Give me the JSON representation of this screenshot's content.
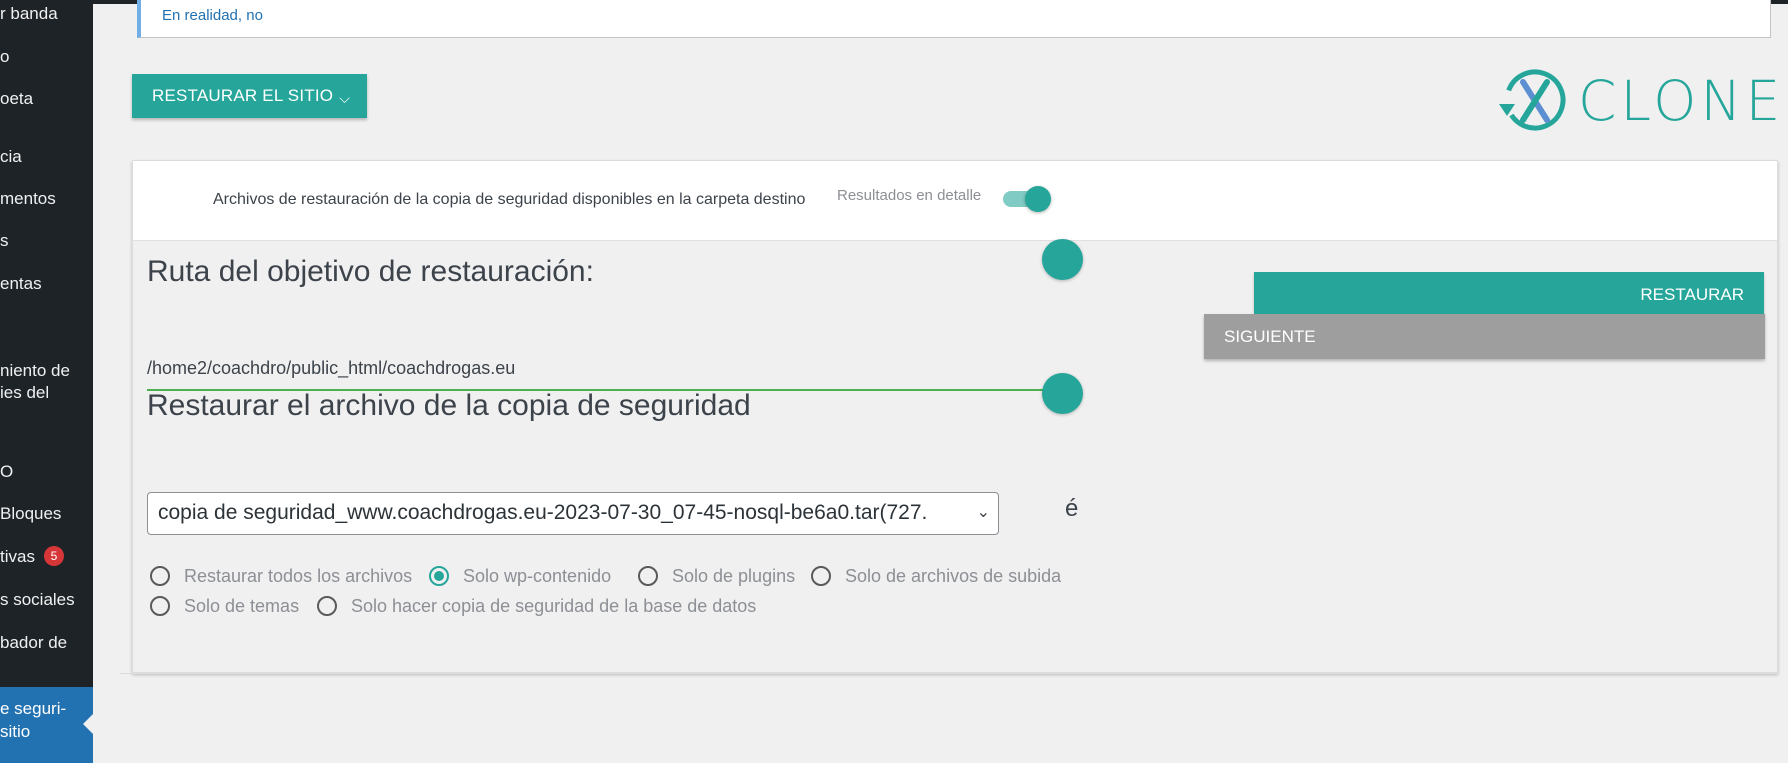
{
  "sidebar": {
    "items": [
      {
        "label": "r banda"
      },
      {
        "label": "o"
      },
      {
        "label": "oeta"
      },
      {
        "label": "cia"
      },
      {
        "label": "mentos"
      },
      {
        "label": "s"
      },
      {
        "label": "entas"
      },
      {
        "label": "niento de"
      },
      {
        "label": "ies del"
      },
      {
        "label": "O"
      },
      {
        "label": "Bloques"
      },
      {
        "label": "tivas",
        "badge": "5"
      },
      {
        "label": "s sociales"
      },
      {
        "label": "bador de"
      }
    ],
    "active_line1": "e seguri-",
    "active_line2": "sitio"
  },
  "notice": {
    "text": "En realidad, no"
  },
  "toolbar": {
    "restore_site_label": "RESTAURAR EL SITIO"
  },
  "logo": {
    "text": "CLONER",
    "letter": "X"
  },
  "card": {
    "header_text": "Archivos de restauración de la copia de seguridad disponibles en la carpeta destino",
    "detail_label": "Resultados en detalle",
    "detail_toggle_on": true
  },
  "restore_target": {
    "title": "Ruta del objetivo de restauración:",
    "path_value": "/home2/coachdro/public_html/coachdrogas.eu"
  },
  "restore_file": {
    "title": "Restaurar el archivo de la copia de seguridad",
    "selected": "copia de seguridad_www.coachdrogas.eu-2023-07-30_07-45-nosql-be6a0.tar(727.",
    "trailing_char": "é"
  },
  "restore_options": [
    {
      "label": "Restaurar todos los archivos",
      "checked": false
    },
    {
      "label": "Solo wp-contenido",
      "checked": true
    },
    {
      "label": "Solo de plugins",
      "checked": false
    },
    {
      "label": "Solo de archivos de subida",
      "checked": false
    },
    {
      "label": "Solo de temas",
      "checked": false
    },
    {
      "label": "Solo hacer copia de seguridad de la base de datos",
      "checked": false
    }
  ],
  "actions": {
    "restore_label": "RESTAURAR",
    "next_label": "SIGUIENTE"
  },
  "colors": {
    "accent": "#26a69a",
    "sidebar": "#1d2327",
    "active": "#2271b1",
    "next": "#9e9e9e"
  }
}
